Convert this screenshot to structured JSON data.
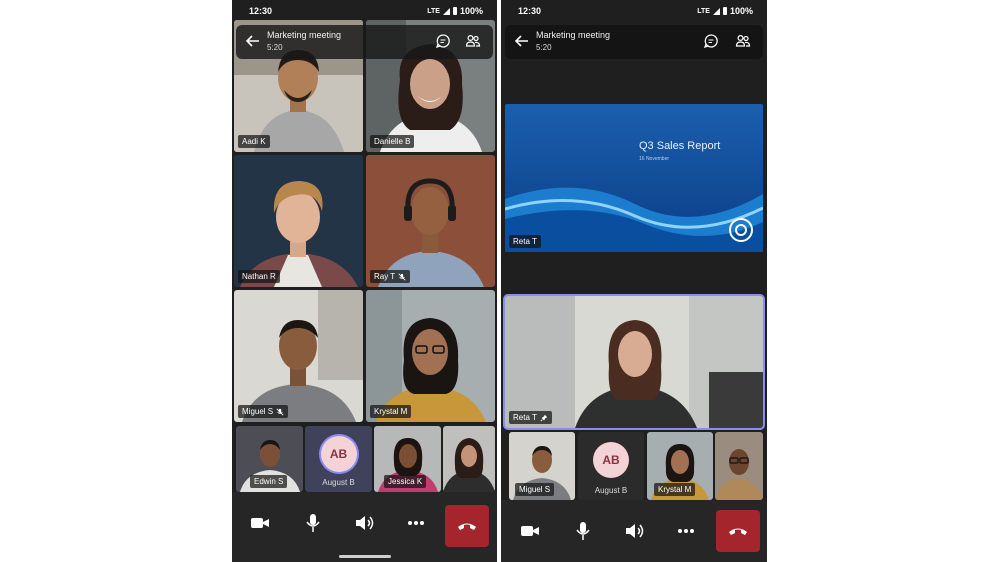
{
  "status": {
    "time": "12:30",
    "network": "LTE",
    "battery": "100%"
  },
  "meeting": {
    "title": "Marketing meeting",
    "elapsed": "5:20"
  },
  "left_grid": [
    {
      "name": "Aadi K",
      "muted": false
    },
    {
      "name": "Danielle B",
      "muted": false
    },
    {
      "name": "Nathan R",
      "muted": false
    },
    {
      "name": "Ray T",
      "muted": true
    },
    {
      "name": "Miguel S",
      "muted": true
    },
    {
      "name": "Krystal M",
      "muted": false
    }
  ],
  "left_strip": [
    {
      "name": "Edwin S",
      "kind": "video"
    },
    {
      "name": "August B",
      "kind": "avatar",
      "initials": "AB"
    },
    {
      "name": "Jessica K",
      "kind": "video"
    },
    {
      "name": "",
      "kind": "video"
    }
  ],
  "right": {
    "presenter": "Reta T",
    "slide": {
      "title": "Q3 Sales Report",
      "subtitle": "16 November"
    },
    "featured": {
      "name": "Reta T",
      "pinned": true
    },
    "strip": [
      {
        "name": "Miguel S",
        "kind": "video"
      },
      {
        "name": "August B",
        "kind": "avatar",
        "initials": "AB"
      },
      {
        "name": "Krystal M",
        "kind": "video"
      },
      {
        "name": "",
        "kind": "video"
      }
    ]
  },
  "controls": [
    "camera-icon",
    "microphone-icon",
    "speaker-icon",
    "more-icon",
    "hang-up-icon"
  ],
  "colors": {
    "hangup": "#a4262c",
    "highlight": "#8b8cf0",
    "avatar_bg": "#f3d3d6",
    "avatar_text": "#8a3340"
  }
}
